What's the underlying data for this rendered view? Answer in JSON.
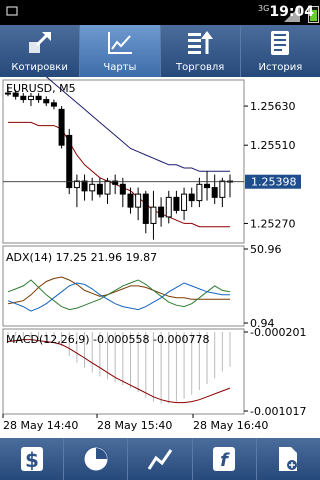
{
  "status_bar": {
    "time": "19:04",
    "network": "3G"
  },
  "tabs": [
    {
      "label": "Котировки",
      "icon": "expand-arrows-icon"
    },
    {
      "label": "Чарты",
      "icon": "line-chart-icon",
      "active": true
    },
    {
      "label": "Торговля",
      "icon": "trade-list-icon"
    },
    {
      "label": "История",
      "icon": "history-book-icon"
    }
  ],
  "bottom_toolbar": [
    {
      "icon": "dollar-icon"
    },
    {
      "icon": "clock-pie-icon"
    },
    {
      "icon": "chart-type-icon"
    },
    {
      "icon": "indicators-function-icon"
    },
    {
      "icon": "add-object-icon"
    }
  ],
  "colors": {
    "nav": "#2f5286",
    "ma_upper": "#1c1c6e",
    "ma_lower": "#8b0000",
    "macd_signal": "#8b0000",
    "macd_hist": "#bbbbbb",
    "adx": "#7a3a00",
    "plus_di": "#2e7d32",
    "minus_di": "#1565c0",
    "price_tag": "#1f4e8c"
  },
  "chart_data": [
    {
      "type": "candlestick",
      "title": "EURUSD, M5",
      "y_ticks": [
        "1.25630",
        "1.25510",
        "1.25270"
      ],
      "current_price": "1.25398",
      "ylim": [
        1.2521,
        1.2571
      ],
      "x_labels": [
        "28 May 14:40",
        "28 May 15:40",
        "28 May 16:40"
      ],
      "candles": [
        [
          1.2567,
          1.2569,
          1.2566,
          1.2567
        ],
        [
          1.2567,
          1.2568,
          1.2565,
          1.2566
        ],
        [
          1.2566,
          1.2567,
          1.2564,
          1.2565
        ],
        [
          1.2565,
          1.2567,
          1.2563,
          1.2566
        ],
        [
          1.2566,
          1.2567,
          1.2564,
          1.2565
        ],
        [
          1.2565,
          1.2566,
          1.2563,
          1.2564
        ],
        [
          1.2564,
          1.2565,
          1.2562,
          1.2563
        ],
        [
          1.2562,
          1.2563,
          1.255,
          1.2551
        ],
        [
          1.2554,
          1.2556,
          1.2536,
          1.2538
        ],
        [
          1.2538,
          1.2542,
          1.2532,
          1.254
        ],
        [
          1.254,
          1.2542,
          1.2534,
          1.2537
        ],
        [
          1.2537,
          1.2541,
          1.2534,
          1.2539
        ],
        [
          1.2539,
          1.2541,
          1.2535,
          1.2536
        ],
        [
          1.2536,
          1.2541,
          1.2533,
          1.254
        ],
        [
          1.254,
          1.2542,
          1.2536,
          1.2539
        ],
        [
          1.2539,
          1.2541,
          1.2532,
          1.2536
        ],
        [
          1.2536,
          1.2538,
          1.253,
          1.2532
        ],
        [
          1.2532,
          1.2538,
          1.2528,
          1.2536
        ],
        [
          1.2536,
          1.2537,
          1.2524,
          1.2527
        ],
        [
          1.2527,
          1.2537,
          1.2522,
          1.2532
        ],
        [
          1.2532,
          1.2535,
          1.2526,
          1.2529
        ],
        [
          1.2529,
          1.2537,
          1.2527,
          1.2535
        ],
        [
          1.2535,
          1.2537,
          1.253,
          1.2531
        ],
        [
          1.2531,
          1.2538,
          1.2528,
          1.2536
        ],
        [
          1.2536,
          1.2538,
          1.2532,
          1.2534
        ],
        [
          1.2534,
          1.2541,
          1.2532,
          1.2539
        ],
        [
          1.2539,
          1.2543,
          1.2534,
          1.2538
        ],
        [
          1.2538,
          1.2542,
          1.2533,
          1.2535
        ],
        [
          1.2535,
          1.2541,
          1.2532,
          1.254
        ],
        [
          1.254,
          1.2542,
          1.2535,
          1.254
        ]
      ],
      "ma_slow": [
        1.2582,
        1.258,
        1.2578,
        1.2576,
        1.2574,
        1.2572,
        1.257,
        1.2568,
        1.2566,
        1.2564,
        1.2562,
        1.256,
        1.2558,
        1.2556,
        1.2554,
        1.2552,
        1.255,
        1.2549,
        1.2548,
        1.2547,
        1.2546,
        1.2545,
        1.2545,
        1.2544,
        1.2544,
        1.2543,
        1.2543,
        1.2543,
        1.2543,
        1.2543
      ],
      "ma_fast": [
        1.2558,
        1.2558,
        1.2558,
        1.2558,
        1.2557,
        1.2557,
        1.2557,
        1.2556,
        1.2552,
        1.2548,
        1.2545,
        1.2543,
        1.2541,
        1.254,
        1.2539,
        1.2538,
        1.2537,
        1.2535,
        1.2533,
        1.2531,
        1.253,
        1.2529,
        1.2528,
        1.2527,
        1.2527,
        1.2526,
        1.2526,
        1.2526,
        1.2526,
        1.2526
      ]
    },
    {
      "type": "line",
      "title": "ADX(14) 17.25 21.96 19.87",
      "y_ticks": [
        "50.96",
        "0.94"
      ],
      "ylim": [
        0.94,
        50.96
      ],
      "series": [
        {
          "values": [
            14,
            15,
            16,
            20,
            25,
            29,
            31,
            32,
            30,
            27,
            23,
            21,
            19,
            20,
            22,
            24,
            26,
            26,
            25,
            23,
            21,
            19,
            18,
            18,
            17,
            17,
            17,
            17,
            17,
            17
          ]
        },
        {
          "values": [
            22,
            24,
            26,
            30,
            25,
            20,
            16,
            12,
            10,
            11,
            13,
            15,
            17,
            20,
            23,
            26,
            28,
            30,
            27,
            23,
            19,
            15,
            13,
            12,
            14,
            18,
            22,
            26,
            23,
            22
          ]
        },
        {
          "values": [
            16,
            14,
            12,
            9,
            11,
            14,
            18,
            22,
            26,
            28,
            27,
            24,
            20,
            17,
            14,
            12,
            11,
            10,
            12,
            15,
            18,
            22,
            25,
            28,
            26,
            24,
            22,
            21,
            20,
            20
          ]
        }
      ]
    },
    {
      "type": "bar+line",
      "title": "MACD(12,26,9) -0.000558 -0.000778",
      "y_ticks": [
        "-0.000201",
        "-0.001017"
      ],
      "ylim": [
        -0.001017,
        -0.000201
      ],
      "histogram": [
        -0.00023,
        -0.00024,
        -0.00025,
        -0.00026,
        -0.00027,
        -0.00028,
        -0.0003,
        -0.00035,
        -0.00045,
        -0.00052,
        -0.00057,
        -0.00062,
        -0.00066,
        -0.00069,
        -0.00072,
        -0.00075,
        -0.00078,
        -0.00082,
        -0.00088,
        -0.00092,
        -0.00094,
        -0.00094,
        -0.00092,
        -0.00089,
        -0.00085,
        -0.0008,
        -0.00074,
        -0.00068,
        -0.00061,
        -0.00056
      ],
      "signal": [
        -0.0003,
        -0.00029,
        -0.00028,
        -0.00028,
        -0.00029,
        -0.0003,
        -0.00031,
        -0.00033,
        -0.00037,
        -0.00042,
        -0.00047,
        -0.00052,
        -0.00057,
        -0.00062,
        -0.00067,
        -0.00071,
        -0.00075,
        -0.00079,
        -0.00083,
        -0.00087,
        -0.0009,
        -0.00092,
        -0.00093,
        -0.00093,
        -0.00092,
        -0.0009,
        -0.00087,
        -0.00084,
        -0.00081,
        -0.00078
      ]
    }
  ]
}
